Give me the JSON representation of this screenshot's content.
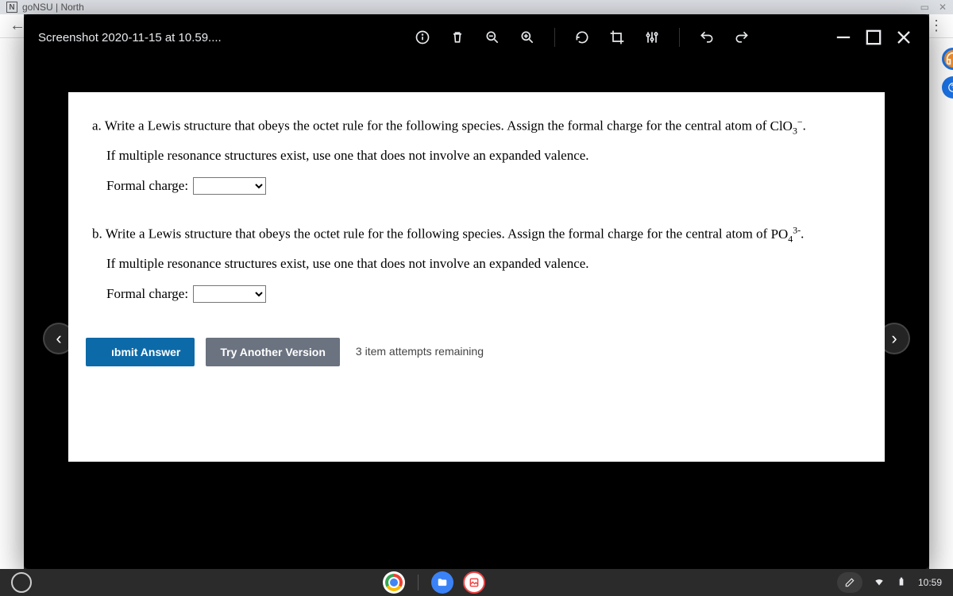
{
  "browser": {
    "tab_favicon_letter": "N",
    "tab_title": "goNSU | North"
  },
  "viewer": {
    "title": "Screenshot 2020-11-15 at 10.59...."
  },
  "content": {
    "qa": {
      "label": "a.",
      "line1_pre": " Write a Lewis structure that obeys the octet rule for the following species. Assign the formal charge for the central atom of ",
      "formula_base": "ClO",
      "formula_sub": "3",
      "formula_sup": "−",
      "line1_post": ".",
      "line2": "If multiple resonance structures exist, use one that does not involve an expanded valence.",
      "fc_label": "Formal charge:"
    },
    "qb": {
      "label": "b.",
      "line1_pre": " Write a Lewis structure that obeys the octet rule for the following species. Assign the formal charge for the central atom of ",
      "formula_base": "PO",
      "formula_sub": "4",
      "formula_sup": "3-",
      "line1_post": ".",
      "line2": "If multiple resonance structures exist, use one that does not involve an expanded valence.",
      "fc_label": "Formal charge:"
    },
    "submit_label": "ıbmit Answer",
    "try_label": "Try Another Version",
    "attempts": "3 item attempts remaining"
  },
  "shelf": {
    "time": "10:59"
  }
}
